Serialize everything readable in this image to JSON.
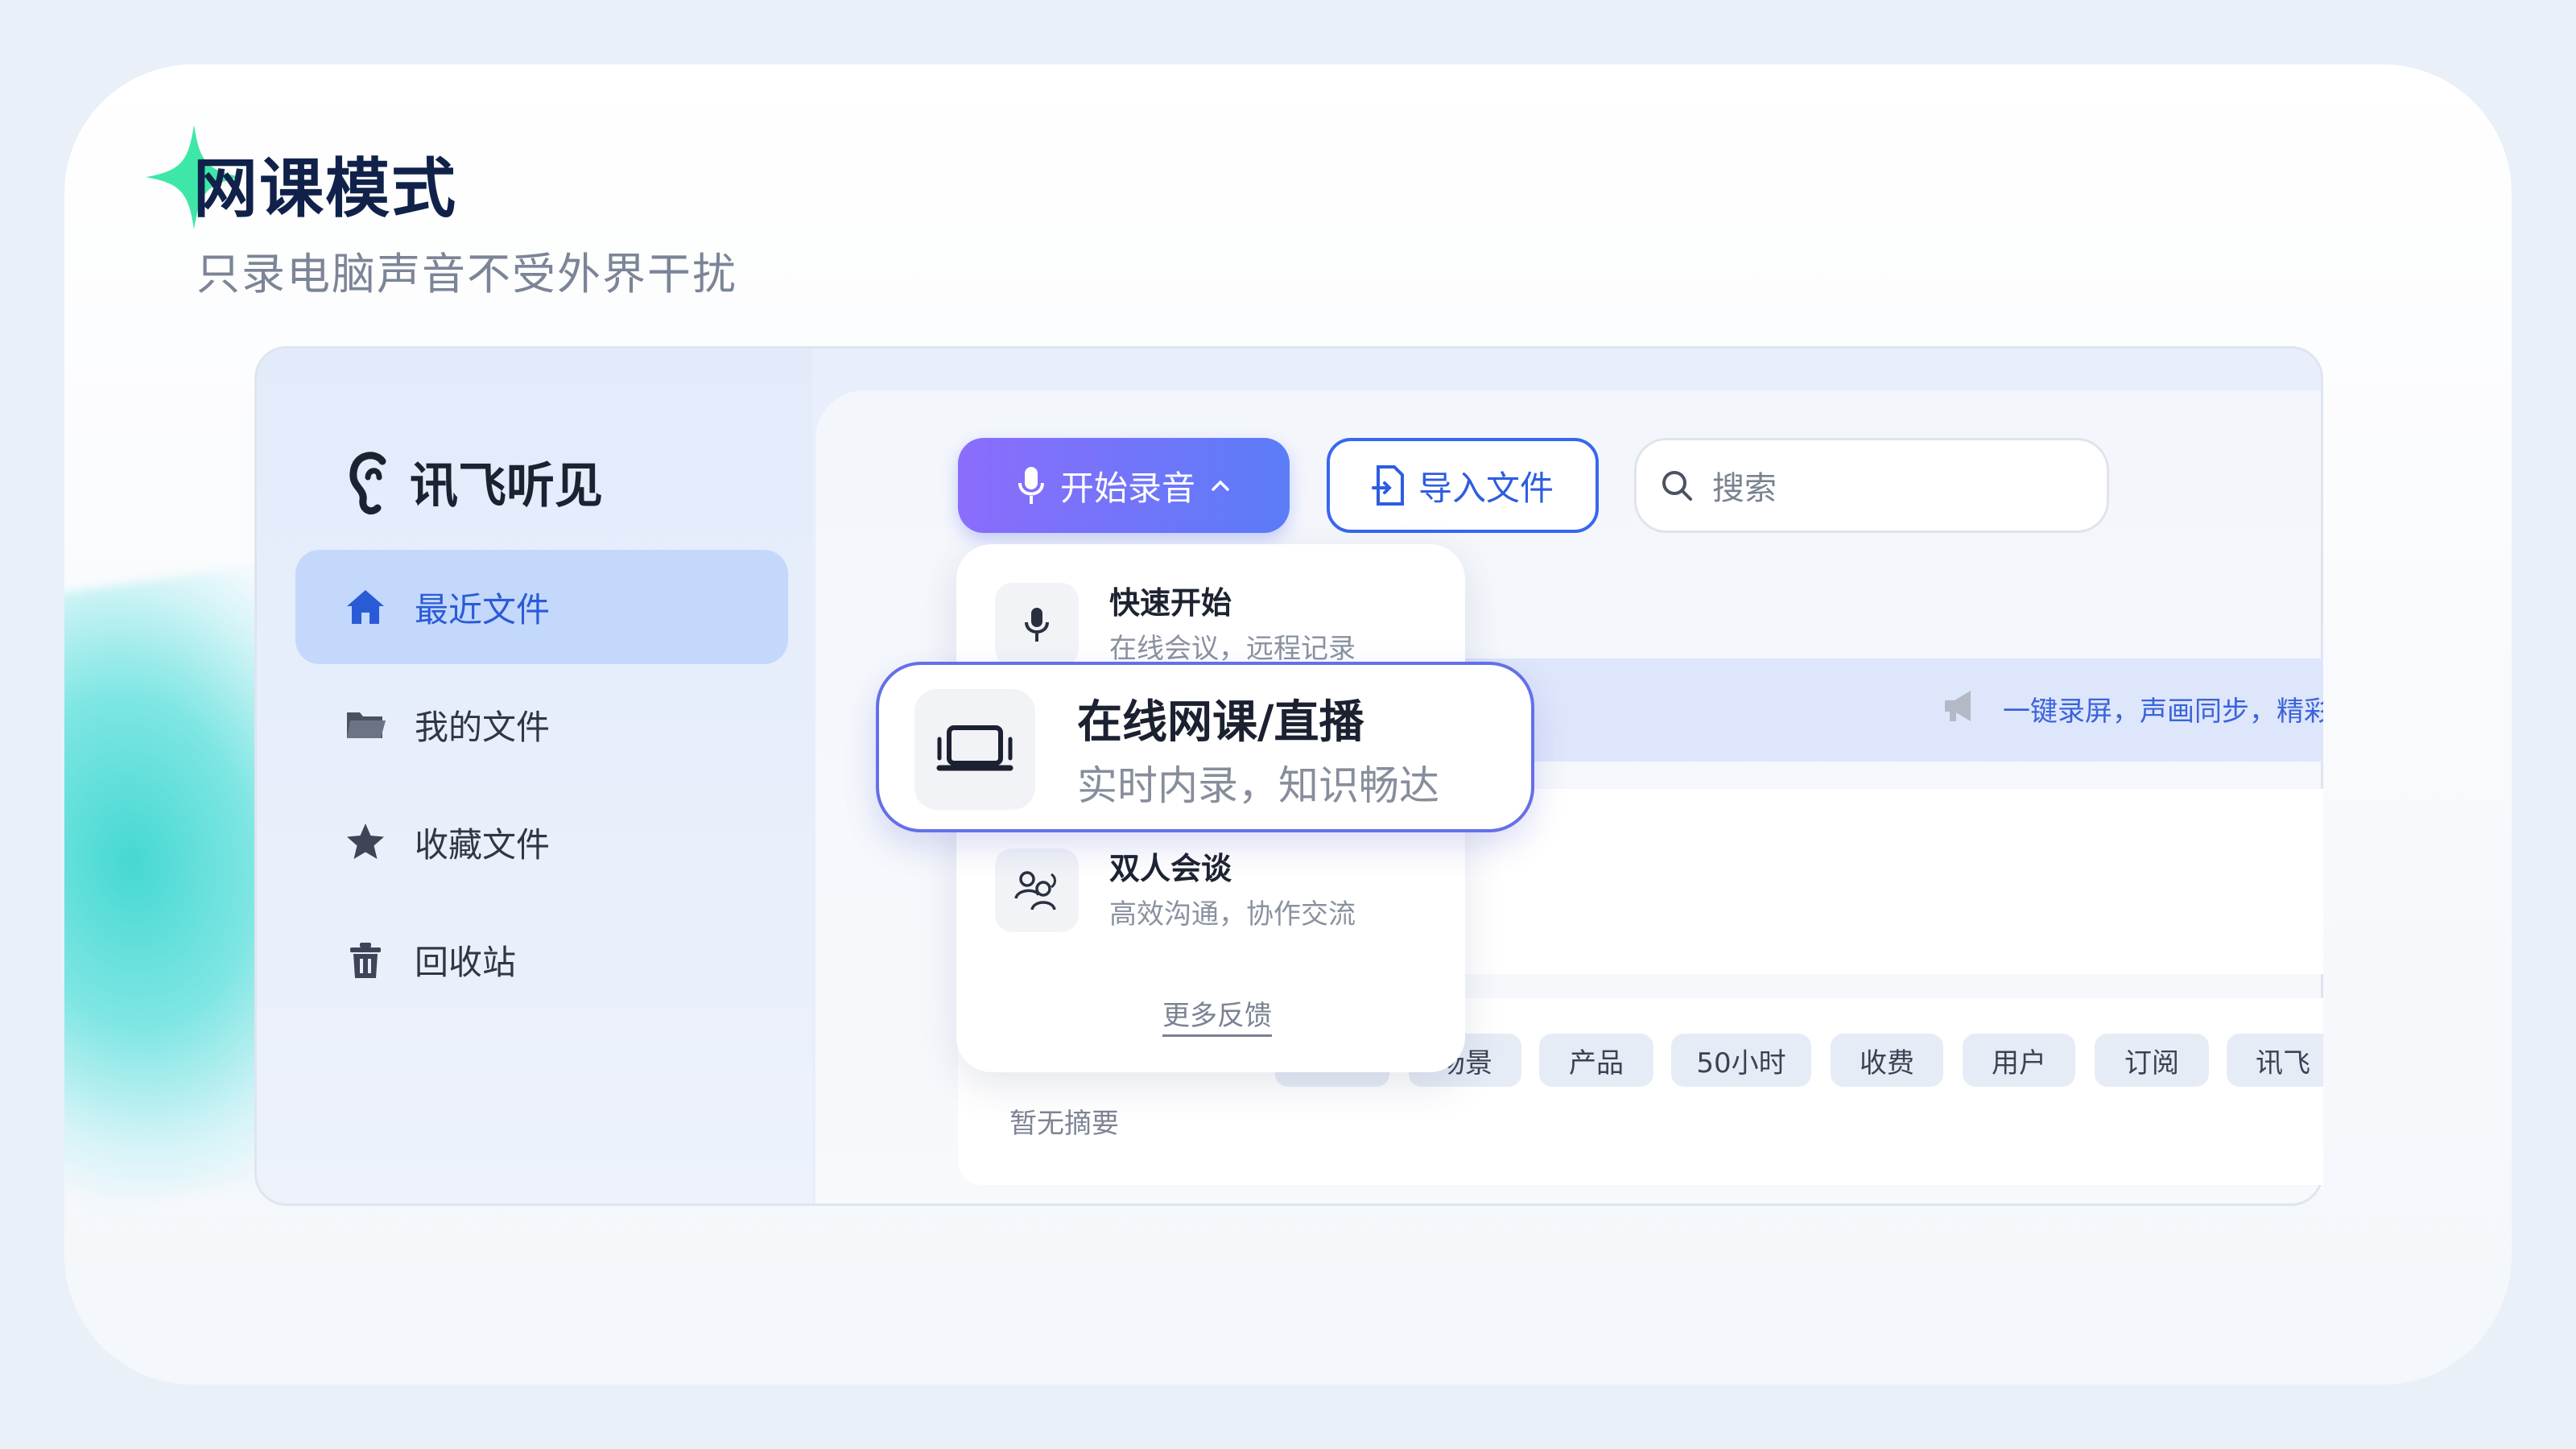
{
  "header": {
    "title": "网课模式",
    "subtitle": "只录电脑声音不受外界干扰"
  },
  "app": {
    "logo_text": "讯飞听见"
  },
  "sidebar": {
    "items": [
      {
        "label": "最近文件",
        "icon": "home-icon",
        "active": true
      },
      {
        "label": "我的文件",
        "icon": "folder-icon",
        "active": false
      },
      {
        "label": "收藏文件",
        "icon": "star-icon",
        "active": false
      },
      {
        "label": "回收站",
        "icon": "trash-icon",
        "active": false
      }
    ]
  },
  "toolbar": {
    "record_label": "开始录音",
    "import_label": "导入文件",
    "search_placeholder": "搜索"
  },
  "dropdown": {
    "items": [
      {
        "title": "快速开始",
        "subtitle": "在线会议，远程记录",
        "icon": "microphone-icon"
      },
      {
        "title": "在线网课/直播",
        "subtitle": "实时内录，知识畅达",
        "icon": "laptop-icon"
      },
      {
        "title": "双人会谈",
        "subtitle": "高效沟通，协作交流",
        "icon": "two-people-icon"
      }
    ],
    "more_label": "更多反馈"
  },
  "banner": {
    "text": "一键录屏，声画同步，精彩"
  },
  "file": {
    "summary": "暂无摘要",
    "tags": [
      "场景",
      "产品",
      "50小时",
      "收费",
      "用户",
      "订阅",
      "讯飞"
    ]
  },
  "colors": {
    "accent": "#3866f0",
    "gradient_start": "#8b6dfc",
    "gradient_end": "#5b7cf8",
    "star": "#3ee7a8"
  }
}
